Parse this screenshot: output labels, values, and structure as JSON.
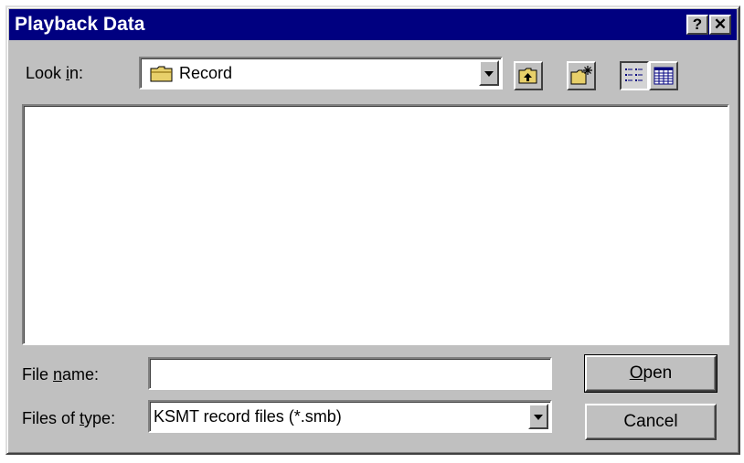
{
  "window": {
    "title": "Playback Data",
    "help_button": "?",
    "close_button": "✕"
  },
  "look_in": {
    "label_pre": "Look ",
    "label_accel": "i",
    "label_post": "n:",
    "value": "Record",
    "icon": "folder-icon"
  },
  "toolbar": {
    "buttons": [
      {
        "name": "up-one-level",
        "icon": "folder-up-icon"
      },
      {
        "name": "create-new-folder",
        "icon": "new-folder-icon"
      },
      {
        "name": "list-view",
        "icon": "list-view-icon",
        "pressed": true
      },
      {
        "name": "details-view",
        "icon": "details-view-icon",
        "pressed": false
      }
    ]
  },
  "file_list": {
    "items": []
  },
  "file_name": {
    "label_pre": "File ",
    "label_accel": "n",
    "label_post": "ame:",
    "value": ""
  },
  "files_of_type": {
    "label_pre": "Files of ",
    "label_accel": "t",
    "label_post": "ype:",
    "value": "KSMT record files (*.smb)"
  },
  "buttons": {
    "open_accel": "O",
    "open_rest": "pen",
    "cancel": "Cancel"
  },
  "colors": {
    "title_bar": "#000080",
    "face": "#c0c0c0",
    "folder_yellow": "#e8d06a"
  }
}
